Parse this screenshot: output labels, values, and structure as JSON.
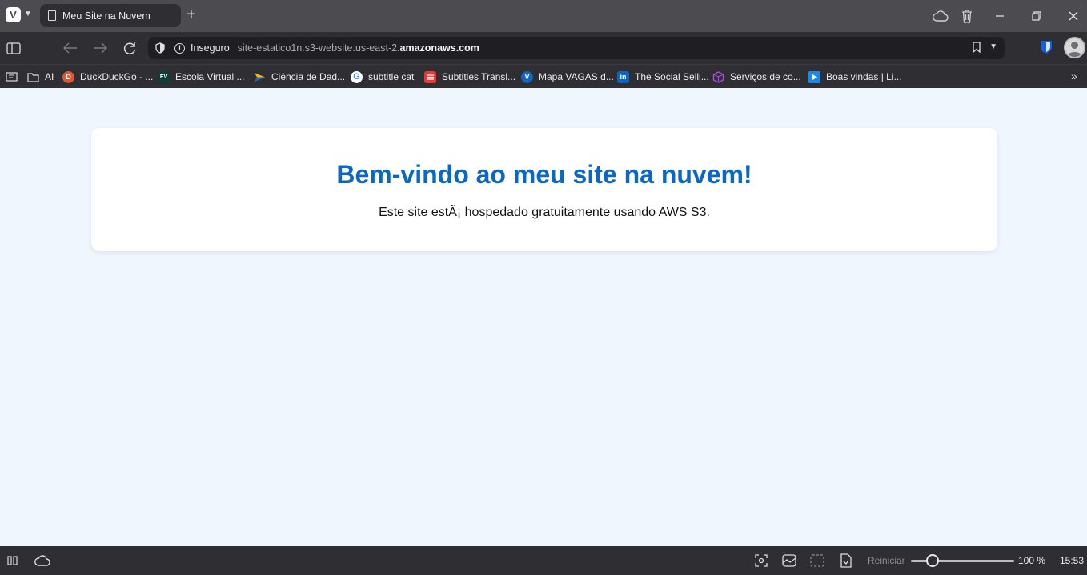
{
  "browser": {
    "tab": {
      "title": "Meu Site na Nuvem"
    },
    "address": {
      "security_label": "Inseguro",
      "url_prefix": "site-estatico1n.s3-website.us-east-2.",
      "url_domain": "amazonaws.com"
    },
    "bookmarks": [
      {
        "label": "AI",
        "icon": "folder-icon",
        "color": "#2e2e33"
      },
      {
        "label": "DuckDuckGo - ...",
        "icon": "duckduckgo-icon",
        "color": "#de5833"
      },
      {
        "label": "Escola Virtual ...",
        "icon": "ev-icon",
        "color": "#0f3d3a"
      },
      {
        "label": "Ciência de Dad...",
        "icon": "arrow-logo-icon",
        "color": "#f2b705"
      },
      {
        "label": "subtitle cat",
        "icon": "google-icon",
        "color": "#ffffff"
      },
      {
        "label": "Subtitles Transl...",
        "icon": "subtitles-icon",
        "color": "#e53935"
      },
      {
        "label": "Mapa VAGAS d...",
        "icon": "vagas-icon",
        "color": "#1565c0"
      },
      {
        "label": "The Social Selli...",
        "icon": "linkedin-icon",
        "color": "#0a66c2"
      },
      {
        "label": "Serviços de co...",
        "icon": "cube-icon",
        "color": "#8e44ad"
      },
      {
        "label": "Boas vindas | Li...",
        "icon": "video-icon",
        "color": "#1e88e5"
      }
    ],
    "status": {
      "reset_label": "Reiniciar",
      "zoom": "100 %",
      "zoom_fraction": 0.2,
      "time": "15:53"
    }
  },
  "page": {
    "heading": "Bem-vindo ao meu site na nuvem!",
    "subtitle": "Este site estÃ¡ hospedado gratuitamente usando AWS S3."
  }
}
